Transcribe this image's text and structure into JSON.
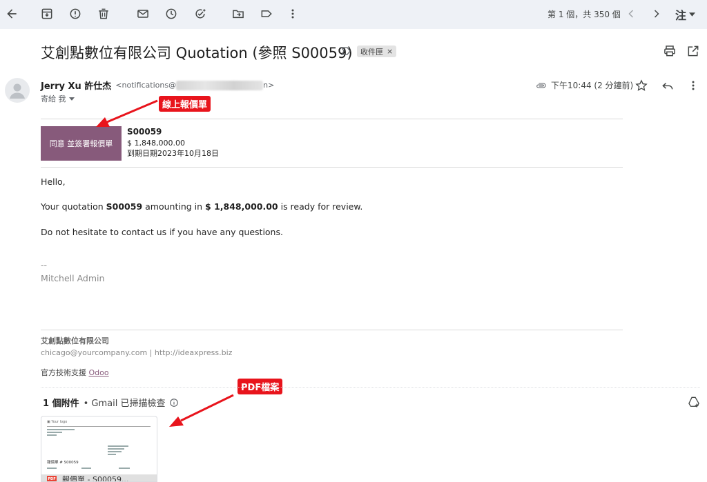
{
  "toolbar": {
    "pager": "第 1 個，共 350 個",
    "lang": "注"
  },
  "email": {
    "subject": "艾創點數位有限公司 Quotation (參照 S00059)",
    "inbox_chip": "收件匣",
    "chip_close": "×",
    "sender_name": "Jerry Xu 許仕杰",
    "sender_email_prefix": "<notifications@",
    "sender_email_suffix": "n>",
    "to_label": "寄給 我",
    "time": "下午10:44 (2 分鐘前)"
  },
  "annotations": {
    "online_quote": "線上報價單",
    "pdf_file": "PDF檔案"
  },
  "quote": {
    "accept_button": "同意 並簽署報價單",
    "id": "S00059",
    "amount": "$ 1,848,000.00",
    "expiry": "到期日期2023年10月18日"
  },
  "body": {
    "greeting": "Hello,",
    "line1_pre": "Your quotation ",
    "line1_id": "S00059",
    "line1_mid": " amounting in ",
    "line1_amount": "$ 1,848,000.00",
    "line1_post": " is ready for review.",
    "line2": "Do not hesitate to contact us if you have any questions.",
    "sig_dash": "--",
    "sig_name": "Mitchell Admin"
  },
  "footer": {
    "company": "艾創點數位有限公司",
    "contact": "chicago@yourcompany.com | http://ideaxpress.biz",
    "powered_pre": "官方技術支援 ",
    "powered_link": "Odoo"
  },
  "attachments": {
    "count": "1 個附件",
    "scan_text": "• Gmail 已掃描檢查",
    "thumb_logo": "▣ Your logo",
    "thumb_doc_title": "報價單 # S00059",
    "thumb_badge": "PDF",
    "thumb_name": "報價單 - S00059..."
  },
  "colors": {
    "odoo_purple": "#875a7b",
    "annotation_red": "#e8141c",
    "toolbar_bg": "#eef1f6"
  }
}
